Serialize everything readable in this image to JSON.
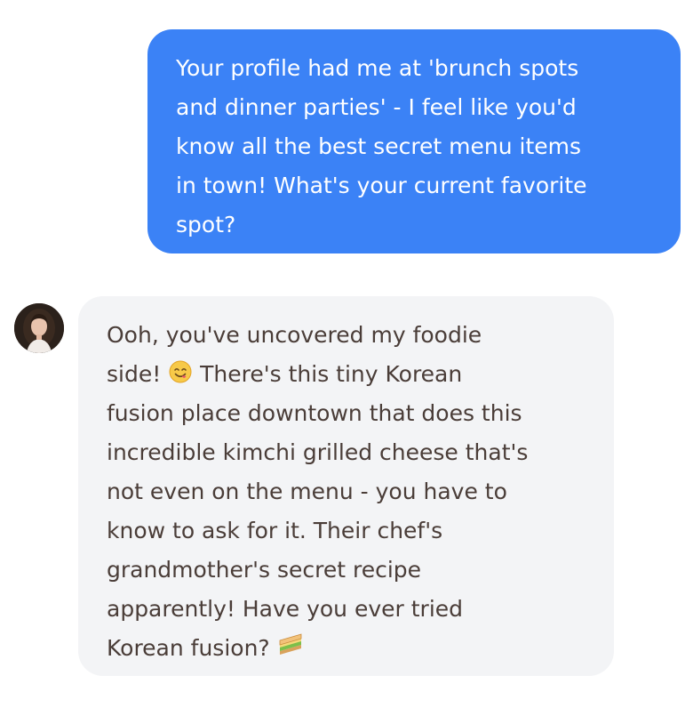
{
  "conversation": {
    "sent_message": {
      "text": "Your profile had me at 'brunch spots\nand dinner parties' - I feel like you'd\nknow all the best secret menu items\nin town! What's your current favorite\nspot?",
      "bubble_color": "#3b82f6",
      "text_color": "#ffffff"
    },
    "received_message": {
      "avatar_icon": "woman-portrait-avatar",
      "text_part1": "Ooh, you've uncovered my foodie\nside! ",
      "emoji1": "😋",
      "text_part2": " There's this tiny Korean\nfusion place downtown that does this\nincredible kimchi grilled cheese that's\nnot even on the menu - you have to\nknow to ask for it. Their chef's\ngrandmother's secret recipe\napparently! Have you ever tried\nKorean fusion? ",
      "emoji2": "🥪",
      "bubble_color": "#f3f4f6",
      "text_color": "#4a3d38"
    }
  }
}
